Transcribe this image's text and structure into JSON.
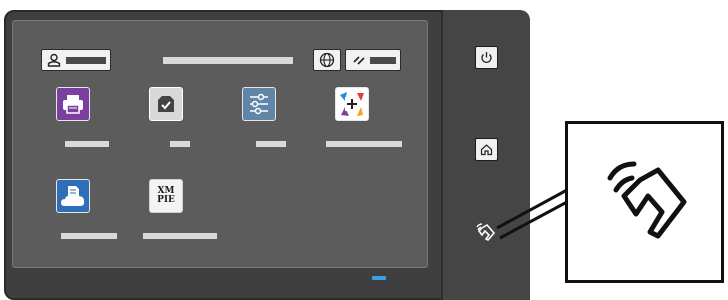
{
  "device": {
    "name": "printer-control-panel"
  },
  "tiles": [
    {
      "name": "print-app",
      "icon": "printer-icon",
      "color": "#7b3fa0"
    },
    {
      "name": "tray-app",
      "icon": "tray-check-icon",
      "color": "#d8d8d8"
    },
    {
      "name": "settings-app",
      "icon": "sliders-icon",
      "color": "#5f86a7"
    },
    {
      "name": "add-app",
      "icon": "plus-icon",
      "color": "#ffffff"
    },
    {
      "name": "cloud-print-app",
      "icon": "cloud-document-icon",
      "color": "#2d6fb8"
    },
    {
      "name": "xmpie-app",
      "icon": "xmpie-logo-icon",
      "color": "#f4f4f4",
      "label": "XM PIE"
    }
  ],
  "xmpie": {
    "line1": "XM",
    "line2": "PIE"
  },
  "hardware_buttons": [
    {
      "name": "power-button",
      "icon": "power-icon"
    },
    {
      "name": "home-button",
      "icon": "home-icon"
    }
  ],
  "nfc": {
    "icon": "nfc-tap-icon"
  },
  "colors": {
    "body": "#3f3f3f",
    "screen": "#5c5c5c",
    "led": "#3aa0e8",
    "accent_purple": "#7b3fa0",
    "accent_blue": "#2d6fb8"
  }
}
